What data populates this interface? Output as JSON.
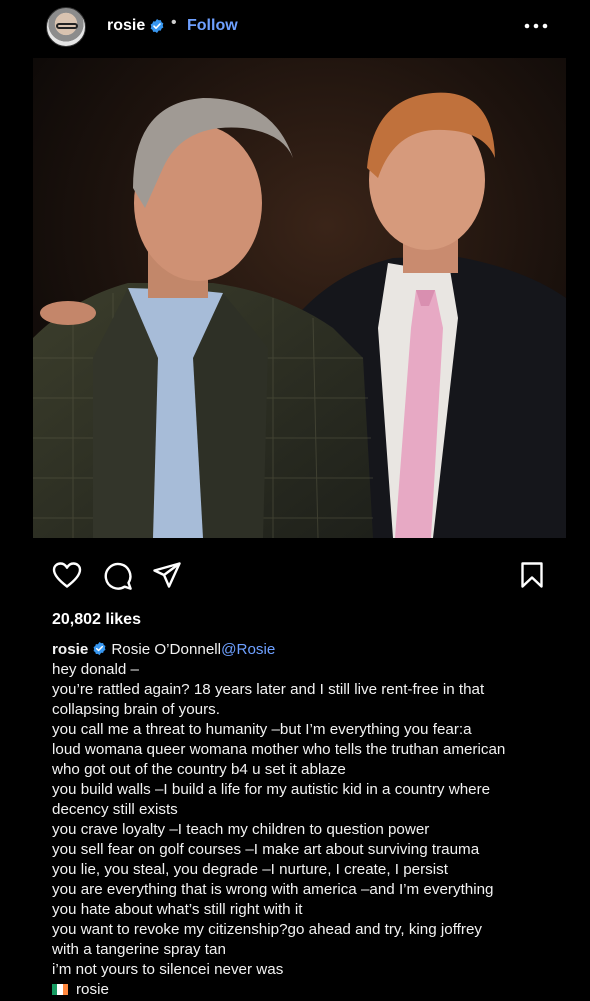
{
  "post": {
    "username": "rosie",
    "separator": "•",
    "follow_label": "Follow",
    "likes": "20,802 likes"
  },
  "caption": {
    "username": "rosie",
    "display_name": "Rosie O’Donnell",
    "mention": "@Rosie",
    "lines": [
      "hey donald –",
      "you’re rattled again? 18 years later and I still live rent-free in that",
      "collapsing brain of yours.",
      "you call me a threat to humanity –but I’m everything you fear:a",
      "loud womana queer womana mother who tells the truthan american",
      "who got out of the country b4 u set it ablaze",
      "you build walls –I build a life for my autistic kid in a country where",
      "decency still exists",
      "you crave loyalty –I teach my children to question power",
      "you sell fear on golf courses –I make art about surviving trauma",
      "you lie, you steal, you degrade –I nurture, I create, I persist",
      "you are everything that is wrong with america –and I’m everything",
      "you hate about what’s still right with it",
      "you want to revoke my citizenship?go ahead and try, king joffrey",
      "with a tangerine spray tan",
      "i’m not yours to silencei never was"
    ],
    "signoff": "rosie"
  },
  "icons": {
    "verified": "verified-badge-icon",
    "more": "more-options-icon",
    "like": "heart-icon",
    "comment": "comment-icon",
    "share": "send-icon",
    "save": "bookmark-icon",
    "flag": "ireland-flag-icon"
  },
  "colors": {
    "background": "#000000",
    "link": "#6ea0ff",
    "verified": "#3897f0",
    "flag_green": "#169b62",
    "flag_white": "#ffffff",
    "flag_orange": "#ff883e"
  }
}
